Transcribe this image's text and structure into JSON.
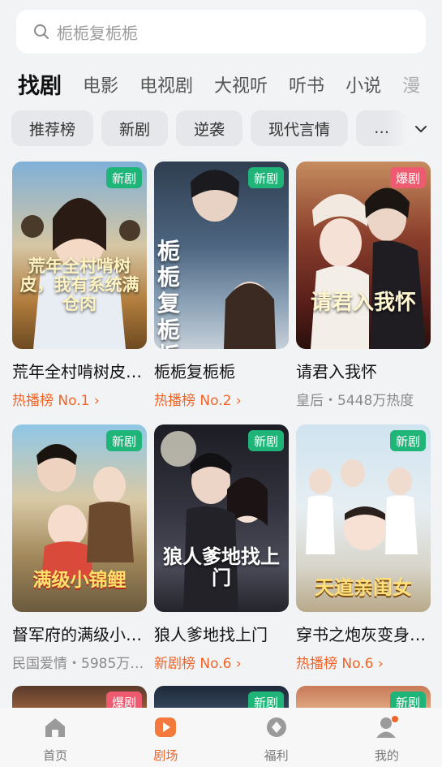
{
  "search": {
    "placeholder": "栀栀复栀栀"
  },
  "tabs": [
    {
      "label": "找剧",
      "active": true
    },
    {
      "label": "电影"
    },
    {
      "label": "电视剧"
    },
    {
      "label": "大视听"
    },
    {
      "label": "听书"
    },
    {
      "label": "小说"
    },
    {
      "label": "漫"
    }
  ],
  "chips": [
    "推荐榜",
    "新剧",
    "逆袭",
    "现代言情",
    "…"
  ],
  "cards": [
    {
      "name": "荒年全村啃树皮，我有系统满仓肉",
      "name_display": "荒年全村啃树皮…",
      "poster_title": "荒年全村啃树皮，我有系统满仓肉",
      "badge": "新剧",
      "badge_type": "new",
      "sub": "热播榜 No.1",
      "sub_type": "rank"
    },
    {
      "name": "栀栀复栀栀",
      "name_display": "栀栀复栀栀",
      "poster_title": "栀栀复栀栀",
      "badge": "新剧",
      "badge_type": "new",
      "sub": "热播榜 No.2",
      "sub_type": "rank"
    },
    {
      "name": "请君入我怀",
      "name_display": "请君入我怀",
      "poster_title": "请君入我怀",
      "badge": "爆剧",
      "badge_type": "hot",
      "sub": "皇后・5448万热度",
      "sub_type": "meta"
    },
    {
      "name": "督军府的满级小锦鲤",
      "name_display": "督军府的满级小…",
      "poster_title": "满级小锦鲤",
      "badge": "新剧",
      "badge_type": "new",
      "sub": "民国爱情・5985万…",
      "sub_type": "meta"
    },
    {
      "name": "狼人爹地找上门",
      "name_display": "狼人爹地找上门",
      "poster_title": "狼人爹地找上门",
      "badge": "新剧",
      "badge_type": "new",
      "sub": "新剧榜 No.6",
      "sub_type": "rank"
    },
    {
      "name": "穿书之炮灰变身天道亲闺女",
      "name_display": "穿书之炮灰变身…",
      "poster_title": "天道亲闺女",
      "badge": "新剧",
      "badge_type": "new",
      "sub": "热播榜 No.6",
      "sub_type": "rank"
    }
  ],
  "partial_badges": [
    {
      "badge": "爆剧",
      "badge_type": "hot"
    },
    {
      "badge": "新剧",
      "badge_type": "new"
    },
    {
      "badge": "新剧",
      "badge_type": "new"
    }
  ],
  "nav": [
    {
      "label": "首页",
      "icon": "home-icon"
    },
    {
      "label": "剧场",
      "icon": "play-icon",
      "active": true
    },
    {
      "label": "福利",
      "icon": "gift-icon"
    },
    {
      "label": "我的",
      "icon": "user-icon"
    }
  ],
  "colors": {
    "accent": "#f06428",
    "new_badge": "#1fb579",
    "hot_badge": "#ee5a6f"
  }
}
